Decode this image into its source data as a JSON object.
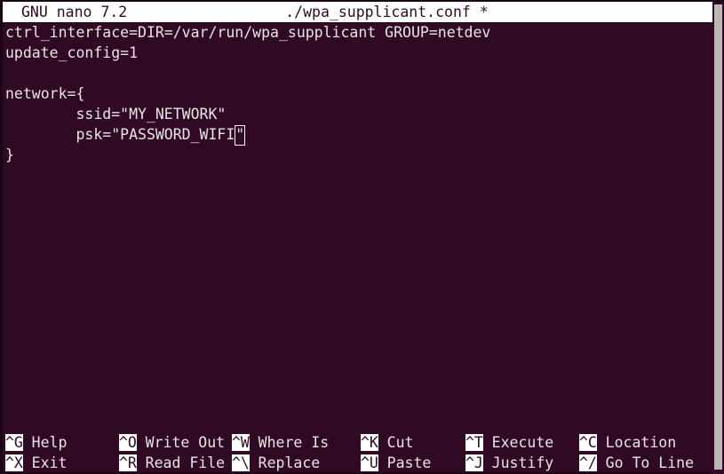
{
  "titlebar": {
    "app": "GNU nano 7.2",
    "filename": "./wpa_supplicant.conf",
    "modified_marker": "*"
  },
  "editor": {
    "lines": [
      "ctrl_interface=DIR=/var/run/wpa_supplicant GROUP=netdev",
      "update_config=1",
      "",
      "network={",
      "        ssid=\"MY_NETWORK\"",
      "        psk=\"PASSWORD_WIFI\"",
      "}"
    ],
    "cursor": {
      "line": 5,
      "column": 22,
      "char": "\""
    },
    "psk_line_before_cursor": "        psk=\"PASSWORD_WIFI",
    "psk_cursor_char": "\""
  },
  "helpbar": {
    "row0": [
      {
        "key": "^G",
        "label": "Help"
      },
      {
        "key": "^O",
        "label": "Write Out"
      },
      {
        "key": "^W",
        "label": "Where Is"
      },
      {
        "key": "^K",
        "label": "Cut"
      },
      {
        "key": "^T",
        "label": "Execute"
      },
      {
        "key": "^C",
        "label": "Location"
      }
    ],
    "row1": [
      {
        "key": "^X",
        "label": "Exit"
      },
      {
        "key": "^R",
        "label": "Read File"
      },
      {
        "key": "^\\",
        "label": "Replace"
      },
      {
        "key": "^U",
        "label": "Paste"
      },
      {
        "key": "^J",
        "label": "Justify"
      },
      {
        "key": "^/",
        "label": "Go To Line"
      }
    ]
  },
  "colors": {
    "background": "#300a24",
    "foreground": "#e8e4e6",
    "inverse_background": "#ffffff",
    "inverse_foreground": "#300a24",
    "scrollbar": "#bdb7b4"
  }
}
